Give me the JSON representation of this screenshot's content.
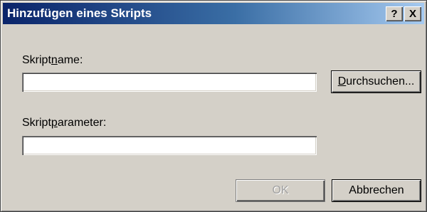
{
  "window": {
    "title": "Hinzufügen eines Skripts",
    "help_label": "?",
    "close_label": "X"
  },
  "form": {
    "script_name": {
      "label_before": "Skript",
      "label_mnemonic": "n",
      "label_after": "ame:",
      "value": ""
    },
    "browse_button": {
      "mnemonic": "D",
      "label_after": "urchsuchen..."
    },
    "script_params": {
      "label_before": "Skript",
      "label_mnemonic": "p",
      "label_after": "arameter:",
      "value": ""
    }
  },
  "buttons": {
    "ok_label": "OK",
    "ok_enabled": false,
    "cancel_label": "Abbrechen"
  }
}
